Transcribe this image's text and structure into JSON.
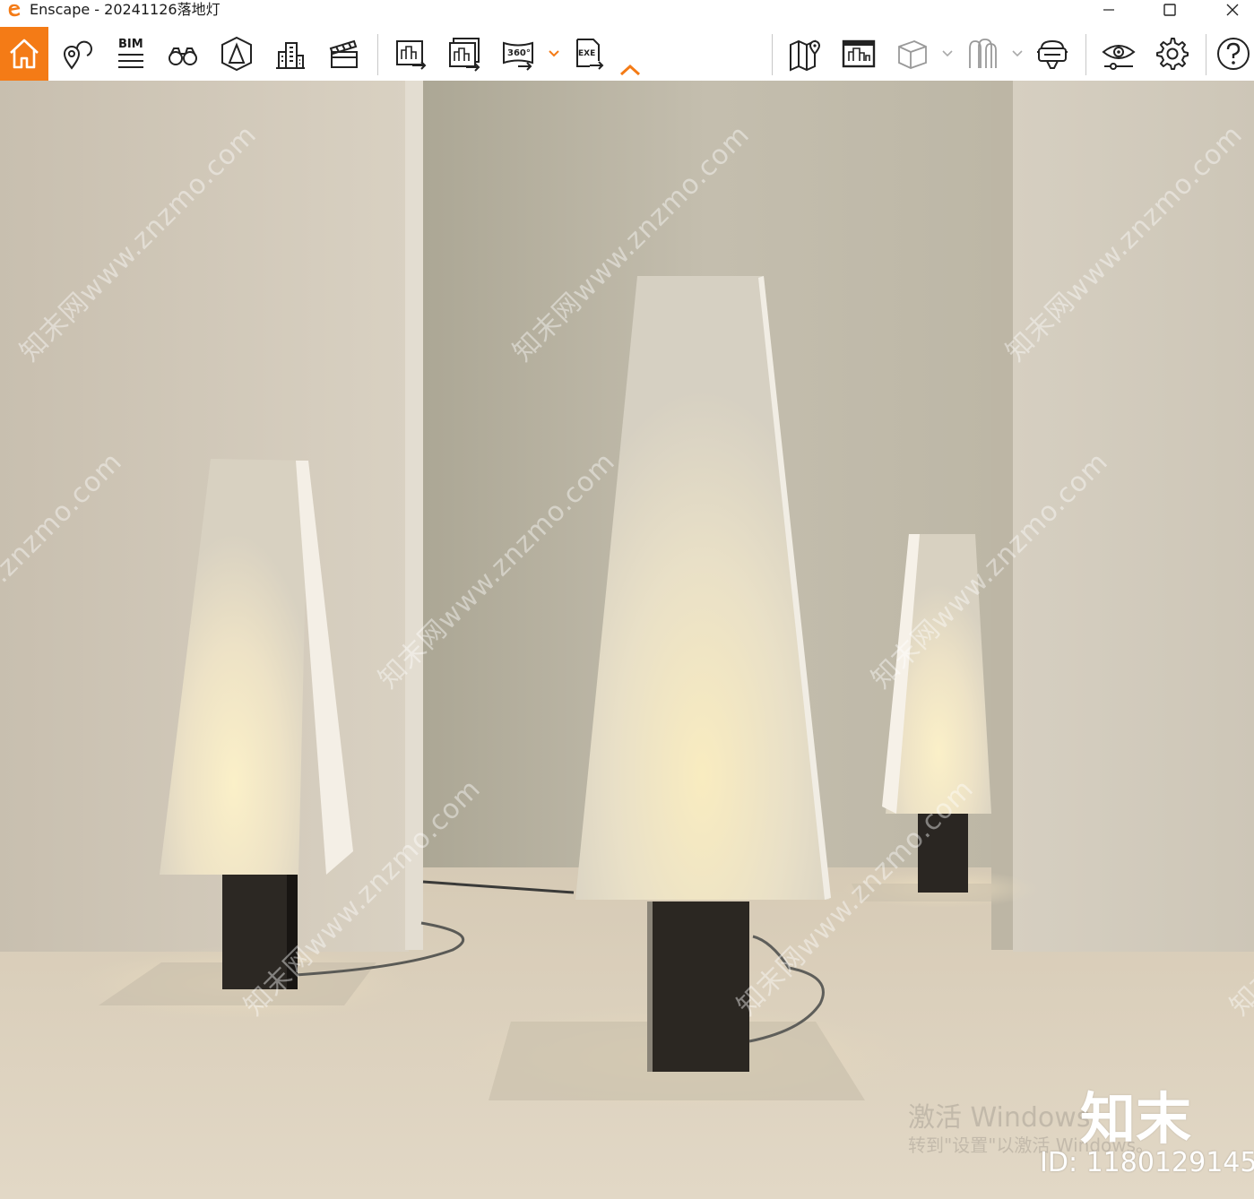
{
  "window": {
    "title": "Enscape - 20241126落地灯",
    "controls": {
      "minimize": "—",
      "maximize": "☐",
      "close": "✕"
    }
  },
  "toolbar": {
    "accent_color": "#f47b16",
    "bim_label": "BIM",
    "panorama_label": "360°",
    "exe_label": "EXE",
    "icons": [
      "home-icon",
      "location-pin-icon",
      "bim-icon",
      "binoculars-icon",
      "perspective-icon",
      "buildings-icon",
      "clapper-icon",
      "screenshot-export-icon",
      "batch-export-icon",
      "panorama-360-icon",
      "exe-export-icon",
      "collapse-chevron-icon",
      "map-icon",
      "view-management-icon",
      "cube-icon",
      "asset-library-icon",
      "vr-headset-icon",
      "eye-icon",
      "gear-icon",
      "help-icon"
    ]
  },
  "viewport": {
    "watermark_text": "知末网www.znzmo.com",
    "activation_title": "激活 Windows",
    "activation_subtitle": "转到\"设置\"以激活 Windows。",
    "brand_logo": "知末",
    "image_id": "ID: 1180129145"
  }
}
